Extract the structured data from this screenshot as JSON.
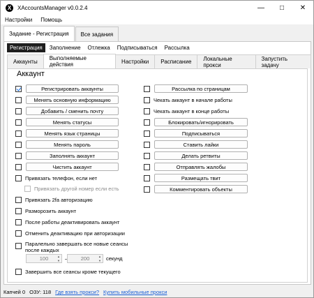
{
  "window": {
    "title": "XAccountsManager v0.0.2.4",
    "logo": "X",
    "controls": [
      "minimize",
      "maximize",
      "close"
    ]
  },
  "menu": [
    "Настройки",
    "Помощь"
  ],
  "main_tabs": [
    {
      "label": "Задание - Регистрация",
      "active": true
    },
    {
      "label": "Все задания",
      "active": false
    }
  ],
  "sub_tabs": [
    {
      "label": "Регистрация",
      "active": true
    },
    {
      "label": "Заполнение",
      "active": false
    },
    {
      "label": "Отлежка",
      "active": false
    },
    {
      "label": "Подписываться",
      "active": false
    },
    {
      "label": "Рассылка",
      "active": false
    }
  ],
  "tabs3": [
    {
      "label": "Аккаунты",
      "active": false
    },
    {
      "label": "Выполняемые действия",
      "active": true
    },
    {
      "label": "Настройки",
      "active": false
    },
    {
      "label": "Расписание",
      "active": false
    },
    {
      "label": "Локальные прокси",
      "active": false
    },
    {
      "label": "Запустить задачу",
      "active": false
    }
  ],
  "section_title": "Аккаунт",
  "left_actions": [
    {
      "label": "Регистрировать аккаунты",
      "checked": true
    },
    {
      "label": "Менять основную информацию",
      "checked": false
    },
    {
      "label": "Добавить / сменить почту",
      "checked": false
    },
    {
      "label": "Менять статусы",
      "checked": false
    },
    {
      "label": "Менять язык страницы",
      "checked": false
    },
    {
      "label": "Менять пароль",
      "checked": false
    },
    {
      "label": "Заполнять аккаунт",
      "checked": false
    },
    {
      "label": "Чистить аккаунт",
      "checked": false
    }
  ],
  "right_actions": [
    {
      "label": "Рассылка по страницам",
      "type": "button"
    },
    {
      "label": "Чекать аккаунт в начале работы",
      "type": "checkbox"
    },
    {
      "label": "Чекать аккаунт в конце работы",
      "type": "checkbox"
    },
    {
      "label": "Блокировать/игнорировать",
      "type": "button"
    },
    {
      "label": "Подписываться",
      "type": "button"
    },
    {
      "label": "Ставить лайки",
      "type": "button"
    },
    {
      "label": "Делать ретвиты",
      "type": "button"
    },
    {
      "label": "Отправлять жалобы",
      "type": "button"
    },
    {
      "label": "Размещать твит",
      "type": "button"
    },
    {
      "label": "Комментировать объекты",
      "type": "button"
    }
  ],
  "options": {
    "bind_phone": "Привязать телефон, если нет",
    "bind_other_phone": "Привязать другой номер если есть",
    "bind_2fa": "Привязать 2fa авторизацию",
    "unfreeze": "Разморозить аккаунт",
    "deactivate_after": "После работы деактивировать аккаунт",
    "cancel_deactivation": "Отменить деактивацию при авторизации",
    "parallel_sessions": "Паралельно завершать все новые сеансы после каждых",
    "range_from": "100",
    "range_dash": "—",
    "range_to": "200",
    "seconds": "секунд",
    "end_all_sessions": "Завершить все сеансы кроме текущего"
  },
  "status": {
    "captcha": "Капчей 0",
    "ram": "ОЗУ: 118",
    "link_proxy": "Где взять прокси?",
    "link_mobile": "Купить мобильные прокси"
  }
}
